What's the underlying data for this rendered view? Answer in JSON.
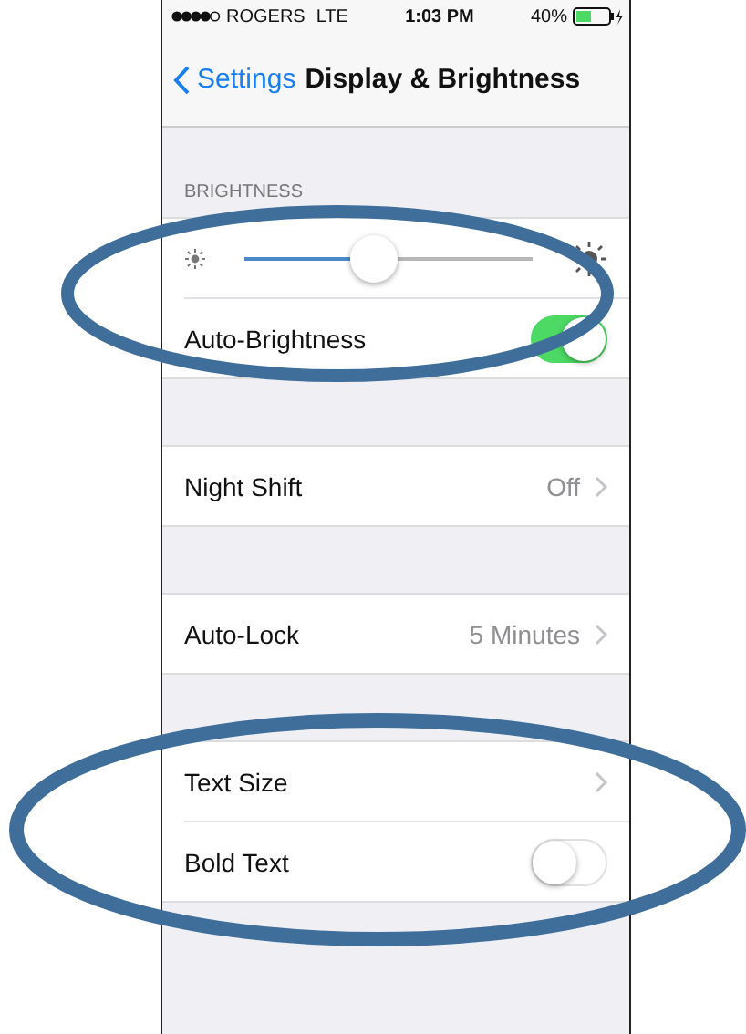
{
  "status_bar": {
    "carrier": "ROGERS",
    "network": "LTE",
    "time": "1:03 PM",
    "battery": "40%"
  },
  "nav": {
    "back": "Settings",
    "title": "Display & Brightness"
  },
  "sections": [
    {
      "header": "BRIGHTNESS",
      "rows": [
        {
          "kind": "slider",
          "level": 0.45
        },
        {
          "kind": "switch",
          "label": "Auto-Brightness",
          "on": true
        }
      ]
    },
    {
      "rows": [
        {
          "kind": "link",
          "label": "Night Shift",
          "value": "Off"
        }
      ]
    },
    {
      "rows": [
        {
          "kind": "link",
          "label": "Auto-Lock",
          "value": "5 Minutes"
        }
      ]
    },
    {
      "rows": [
        {
          "kind": "link",
          "label": "Text Size"
        },
        {
          "kind": "switch",
          "label": "Bold Text",
          "on": false
        }
      ]
    }
  ]
}
